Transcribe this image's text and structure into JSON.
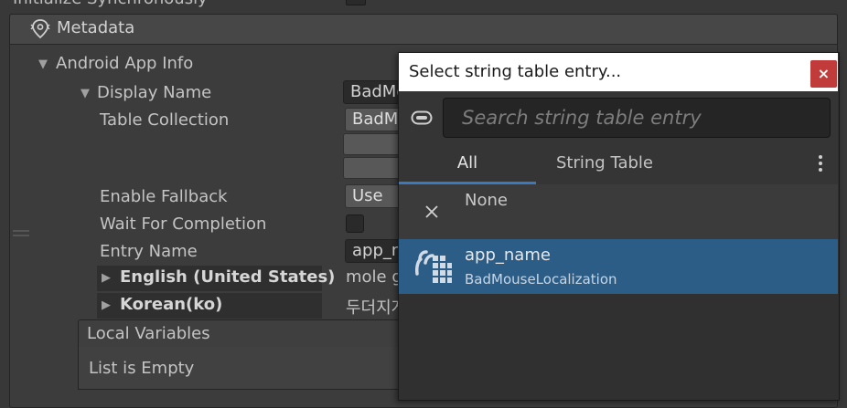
{
  "top": {
    "label": "Initialize Synchronously"
  },
  "metadata": {
    "title": "Metadata",
    "android_app_info": "Android App Info",
    "display_name": "Display Name",
    "display_name_value": "BadMouseLocalization",
    "table_collection": "Table Collection",
    "table_collection_value": "BadMouseLocalization",
    "enable_fallback": "Enable Fallback",
    "enable_fallback_value": "Use Project Settings",
    "wait_for_completion": "Wait For Completion",
    "entry_name": "Entry Name",
    "entry_name_value": "app_name",
    "locales": [
      {
        "label": "English (United States)",
        "value": "mole game"
      },
      {
        "label": "Korean(ko)",
        "value": "두더지게임"
      }
    ],
    "local_variables": "Local Variables",
    "list_empty": "List is Empty"
  },
  "popup": {
    "title": "Select string table entry...",
    "close_label": "×",
    "search_placeholder": "Search string table entry",
    "tabs": [
      {
        "label": "All"
      },
      {
        "label": "String Table"
      }
    ],
    "none_label": "None",
    "entry": {
      "name": "app_name",
      "table": "BadMouseLocalization"
    }
  },
  "colors": {
    "accent": "#3a79bb",
    "selection": "#2c5d87",
    "close": "#c23b3b"
  }
}
